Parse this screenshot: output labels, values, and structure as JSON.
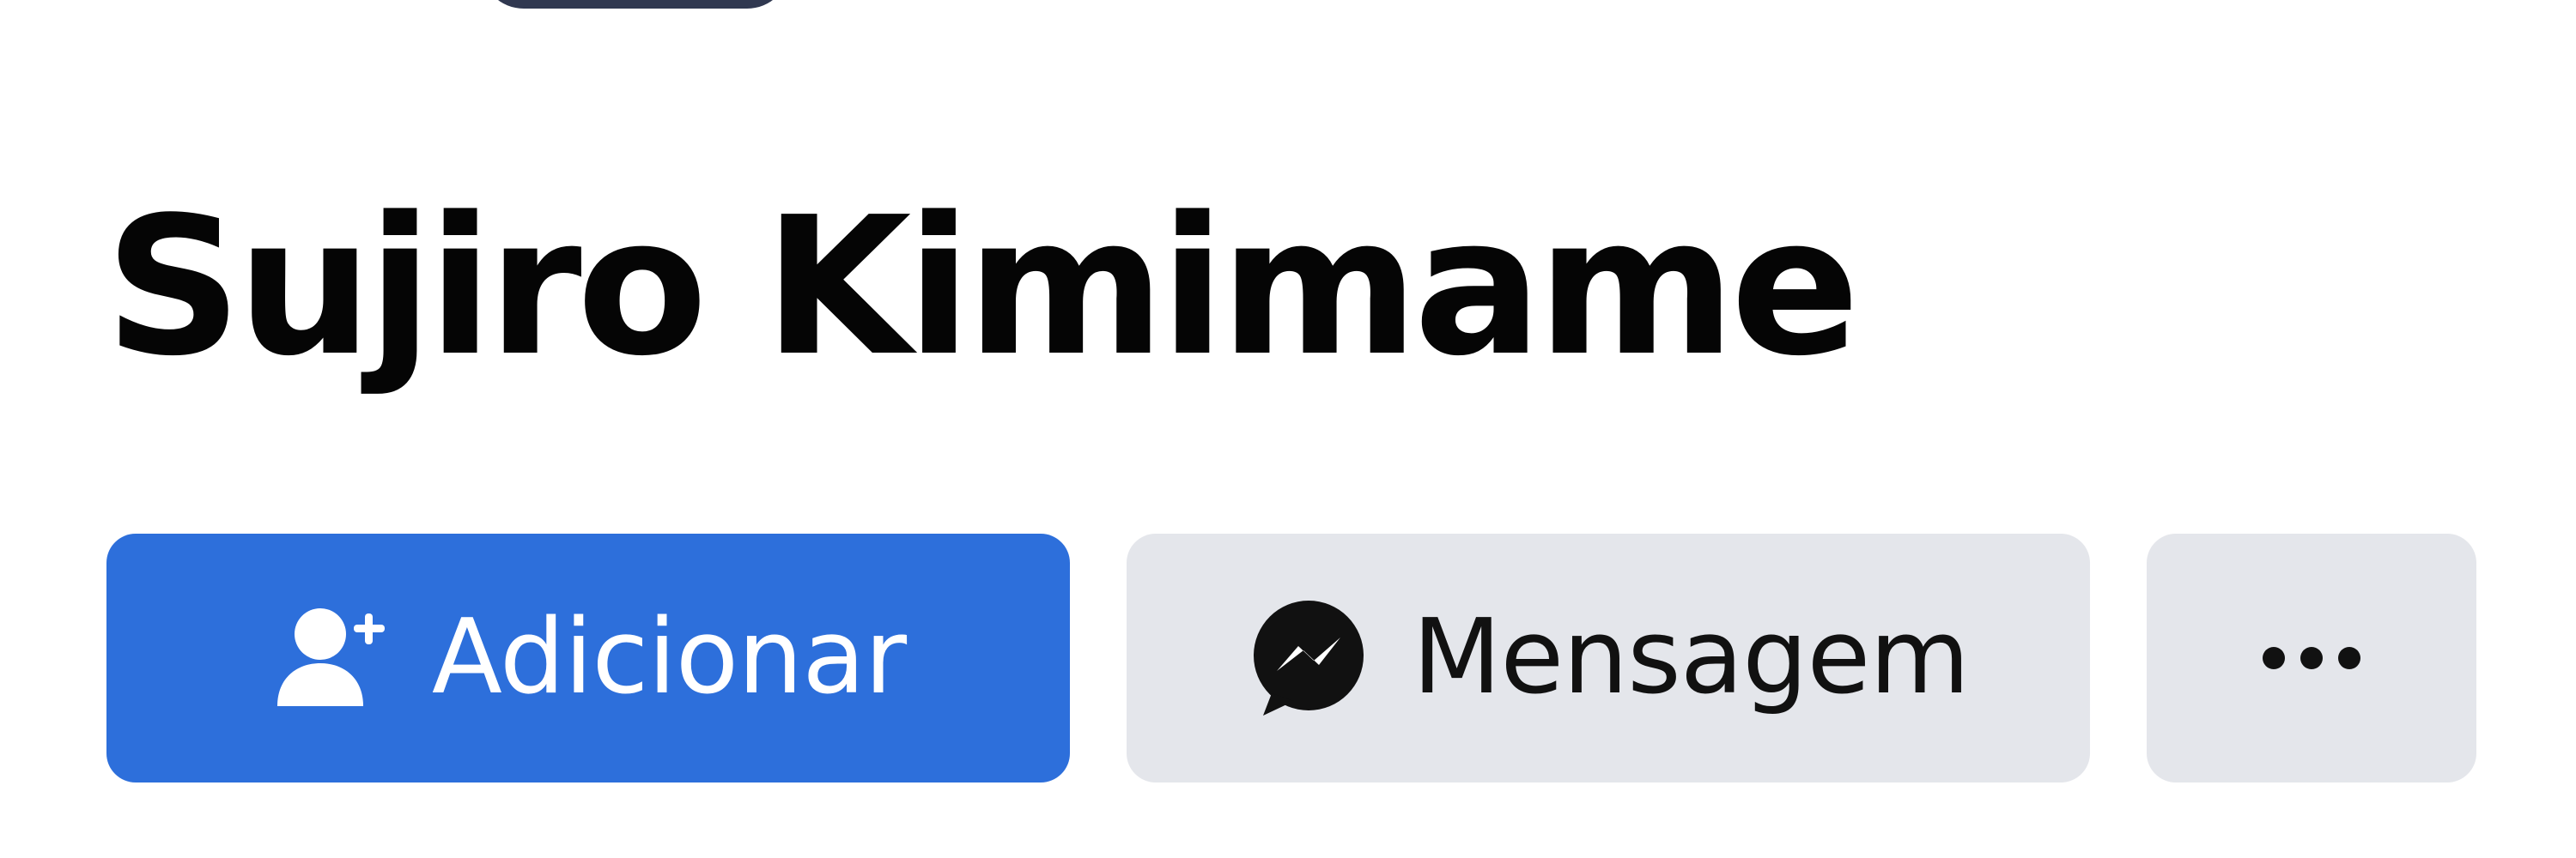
{
  "profile": {
    "name": "Sujiro Kimimame"
  },
  "actions": {
    "add_label": "Adicionar",
    "add_icon": "add-friend-icon",
    "message_label": "Mensagem",
    "message_icon": "messenger-icon",
    "more_icon": "more-options-icon"
  },
  "colors": {
    "primary_button": "#2d6fdb",
    "secondary_button": "#e4e6eb",
    "text": "#050505"
  }
}
